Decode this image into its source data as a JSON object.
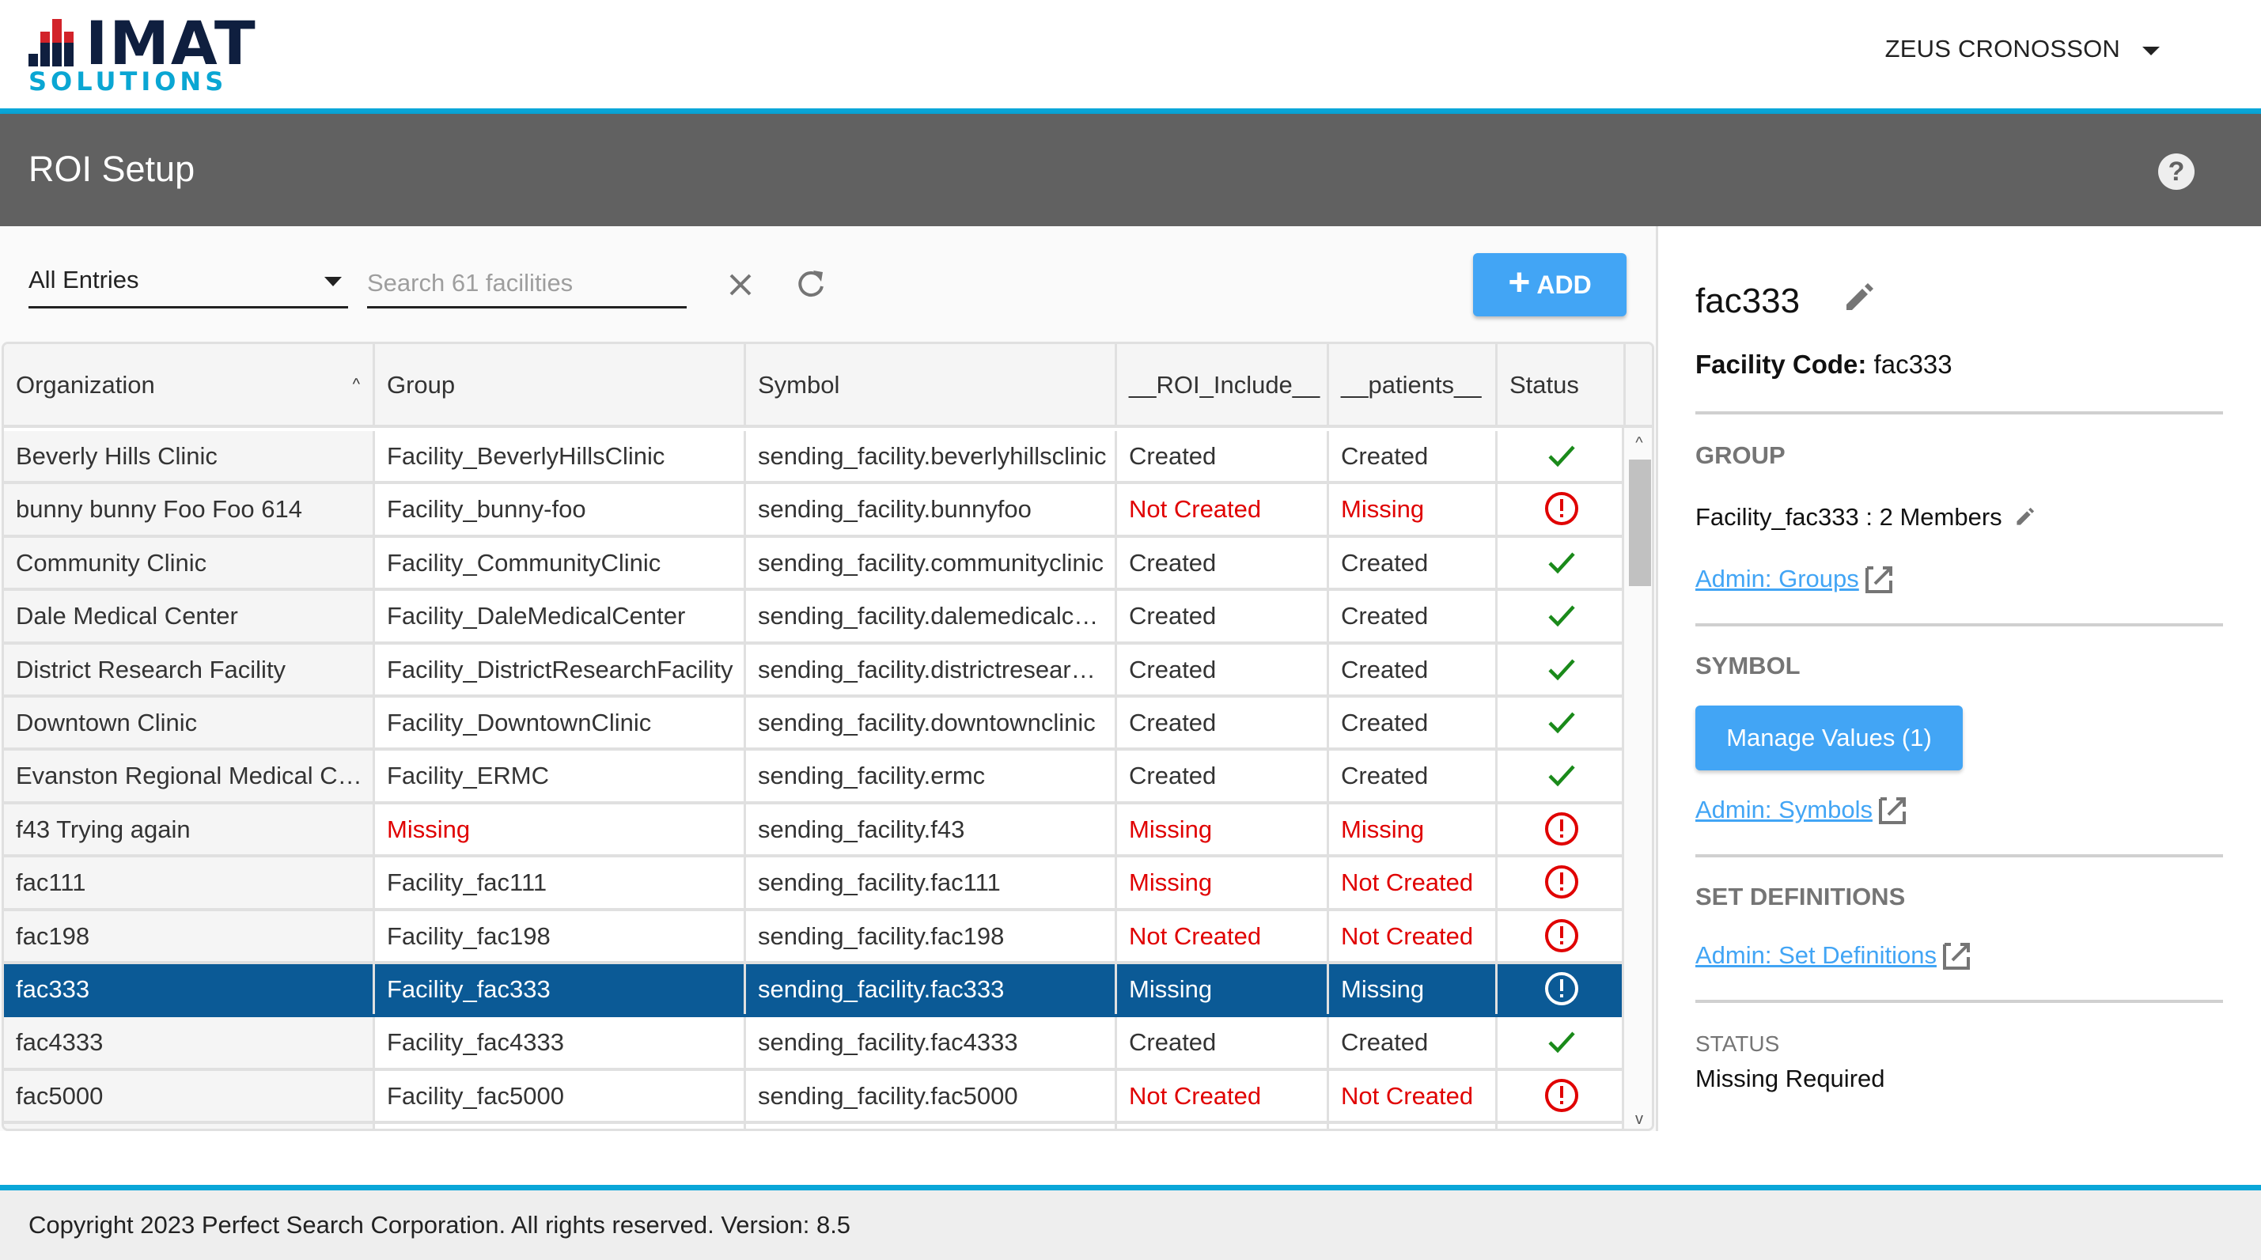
{
  "brand": {
    "name_top": "IMAT",
    "name_bottom": "SOLUTIONS",
    "colors": {
      "navy": "#0f1f3f",
      "red": "#d2232a",
      "cyan": "#0aa6d3"
    }
  },
  "header": {
    "user_name": "ZEUS CRONOSSON",
    "user_menu_icon": "caret-down-icon"
  },
  "title_bar": {
    "title": "ROI Setup",
    "help_icon": "help-circle-icon",
    "help_label": "?"
  },
  "toolbar": {
    "filter_value": "All Entries",
    "search_placeholder": "Search 61 facilities",
    "search_value": "",
    "clear_icon": "close-icon",
    "refresh_icon": "refresh-icon",
    "add_label": "ADD",
    "add_icon": "+"
  },
  "table": {
    "columns": [
      {
        "label": "Organization",
        "sort": "ascending"
      },
      {
        "label": "Group"
      },
      {
        "label": "Symbol"
      },
      {
        "label": "__ROI_Include__"
      },
      {
        "label": "__patients__"
      },
      {
        "label": "Status"
      }
    ],
    "rows": [
      {
        "organization": "Beverly Hills Clinic",
        "group": "Facility_BeverlyHillsClinic",
        "symbol": "sending_facility.beverlyhillsclinic",
        "roi_include": "Created",
        "patients": "Created",
        "status": "ok"
      },
      {
        "organization": "bunny bunny Foo Foo 614",
        "group": "Facility_bunny-foo",
        "symbol": "sending_facility.bunnyfoo",
        "roi_include": "Not Created",
        "patients": "Missing",
        "status": "error"
      },
      {
        "organization": "Community Clinic",
        "group": "Facility_CommunityClinic",
        "symbol": "sending_facility.communityclinic",
        "roi_include": "Created",
        "patients": "Created",
        "status": "ok"
      },
      {
        "organization": "Dale Medical Center",
        "group": "Facility_DaleMedicalCenter",
        "symbol": "sending_facility.dalemedicalc…",
        "roi_include": "Created",
        "patients": "Created",
        "status": "ok"
      },
      {
        "organization": "District Research Facility",
        "group": "Facility_DistrictResearchFacility",
        "symbol": "sending_facility.districtresear…",
        "roi_include": "Created",
        "patients": "Created",
        "status": "ok"
      },
      {
        "organization": "Downtown Clinic",
        "group": "Facility_DowntownClinic",
        "symbol": "sending_facility.downtownclinic",
        "roi_include": "Created",
        "patients": "Created",
        "status": "ok"
      },
      {
        "organization": "Evanston Regional Medical C…",
        "group": "Facility_ERMC",
        "symbol": "sending_facility.ermc",
        "roi_include": "Created",
        "patients": "Created",
        "status": "ok"
      },
      {
        "organization": "f43 Trying again",
        "group": "Missing",
        "symbol": "sending_facility.f43",
        "roi_include": "Missing",
        "patients": "Missing",
        "status": "error"
      },
      {
        "organization": "fac111",
        "group": "Facility_fac111",
        "symbol": "sending_facility.fac111",
        "roi_include": "Missing",
        "patients": "Not Created",
        "status": "error"
      },
      {
        "organization": "fac198",
        "group": "Facility_fac198",
        "symbol": "sending_facility.fac198",
        "roi_include": "Not Created",
        "patients": "Not Created",
        "status": "error"
      },
      {
        "organization": "fac333",
        "group": "Facility_fac333",
        "symbol": "sending_facility.fac333",
        "roi_include": "Missing",
        "patients": "Missing",
        "status": "error",
        "selected": true
      },
      {
        "organization": "fac4333",
        "group": "Facility_fac4333",
        "symbol": "sending_facility.fac4333",
        "roi_include": "Created",
        "patients": "Created",
        "status": "ok"
      },
      {
        "organization": "fac5000",
        "group": "Facility_fac5000",
        "symbol": "sending_facility.fac5000",
        "roi_include": "Not Created",
        "patients": "Not Created",
        "status": "error"
      },
      {
        "organization": "",
        "group": "",
        "symbol": "",
        "roi_include": "",
        "patients": "",
        "status": "error"
      }
    ],
    "status_colors": {
      "ok": "#1a8a1a",
      "error": "#e00000",
      "selected_bg": "#0b5a96"
    }
  },
  "detail": {
    "title": "fac333",
    "facility_code_label": "Facility Code:",
    "facility_code": "fac333",
    "group_section": "GROUP",
    "group_summary": "Facility_fac333 : 2 Members",
    "group_link": "Admin: Groups ",
    "symbol_section": "SYMBOL",
    "manage_values_label": "Manage Values (1)",
    "symbol_link": "Admin: Symbols ",
    "set_definitions_section": "SET DEFINITIONS",
    "set_definitions_link": "Admin: Set Definitions ",
    "status_label": "STATUS",
    "status_value": "Missing Required"
  },
  "footer": {
    "text": "Copyright 2023 Perfect Search Corporation. All rights reserved. Version: 8.5"
  }
}
